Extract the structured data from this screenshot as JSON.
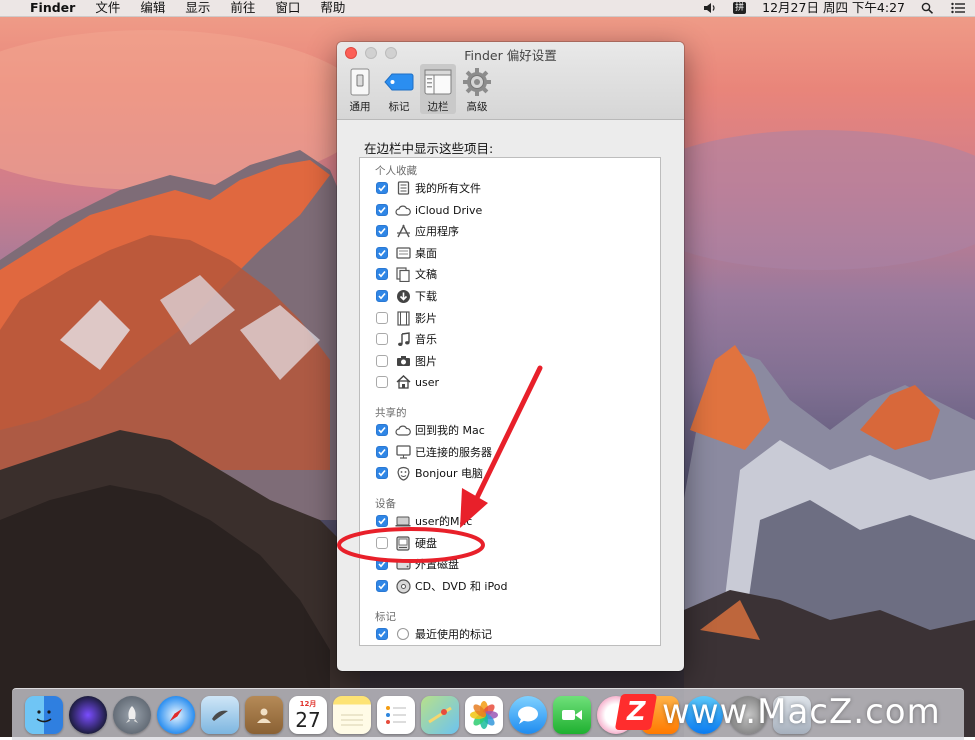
{
  "menubar": {
    "app_name": "Finder",
    "menus": [
      "文件",
      "编辑",
      "显示",
      "前往",
      "窗口",
      "帮助"
    ],
    "input_method_label": "拼",
    "datetime": "12月27日 周四 下午4:27",
    "icons": [
      "volume-icon",
      "input-method-icon",
      "spotlight-search-icon",
      "notification-center-icon"
    ]
  },
  "window": {
    "title": "Finder 偏好设置",
    "tabs": [
      {
        "label": "通用",
        "icon": "general-switch-icon",
        "active": false
      },
      {
        "label": "标记",
        "icon": "tag-icon",
        "active": false
      },
      {
        "label": "边栏",
        "icon": "sidebar-icon",
        "active": true
      },
      {
        "label": "高级",
        "icon": "gear-icon",
        "active": false
      }
    ],
    "heading": "在边栏中显示这些项目:",
    "sections": [
      {
        "title": "个人收藏",
        "items": [
          {
            "label": "我的所有文件",
            "checked": true,
            "icon": "all-files-icon"
          },
          {
            "label": "iCloud Drive",
            "checked": true,
            "icon": "cloud-icon"
          },
          {
            "label": "应用程序",
            "checked": true,
            "icon": "applications-icon"
          },
          {
            "label": "桌面",
            "checked": true,
            "icon": "desktop-icon"
          },
          {
            "label": "文稿",
            "checked": true,
            "icon": "documents-icon"
          },
          {
            "label": "下载",
            "checked": true,
            "icon": "download-icon"
          },
          {
            "label": "影片",
            "checked": false,
            "icon": "movies-icon"
          },
          {
            "label": "音乐",
            "checked": false,
            "icon": "music-icon"
          },
          {
            "label": "图片",
            "checked": false,
            "icon": "camera-icon"
          },
          {
            "label": "user",
            "checked": false,
            "icon": "home-icon"
          }
        ]
      },
      {
        "title": "共享的",
        "items": [
          {
            "label": "回到我的 Mac",
            "checked": true,
            "icon": "cloud-icon"
          },
          {
            "label": "已连接的服务器",
            "checked": true,
            "icon": "server-icon"
          },
          {
            "label": "Bonjour 电脑",
            "checked": true,
            "icon": "bonjour-icon"
          }
        ]
      },
      {
        "title": "设备",
        "items": [
          {
            "label": "user的Mac",
            "checked": true,
            "icon": "laptop-icon"
          },
          {
            "label": "硬盘",
            "checked": false,
            "icon": "hard-disk-icon"
          },
          {
            "label": "外置磁盘",
            "checked": true,
            "icon": "external-disk-icon"
          },
          {
            "label": "CD、DVD 和 iPod",
            "checked": true,
            "icon": "optical-disc-icon"
          }
        ]
      },
      {
        "title": "标记",
        "items": [
          {
            "label": "最近使用的标记",
            "checked": true,
            "icon": "tag-circle-icon"
          }
        ]
      }
    ]
  },
  "dock": {
    "apps": [
      "Finder",
      "Siri",
      "Launchpad",
      "Safari",
      "Mail",
      "Contacts",
      "Calendar",
      "Notes",
      "Reminders",
      "Maps",
      "Photos",
      "Messages",
      "FaceTime",
      "iTunes",
      "iBooks",
      "App Store",
      "System Preferences",
      "Trash"
    ],
    "calendar_month": "12月",
    "calendar_day": "27"
  },
  "watermark": {
    "badge": "Z",
    "text": "www.MacZ.com"
  },
  "colors": {
    "checkbox_on": "#2f86e6",
    "annotation": "#e8202a",
    "close_button": "#fc5f57"
  }
}
